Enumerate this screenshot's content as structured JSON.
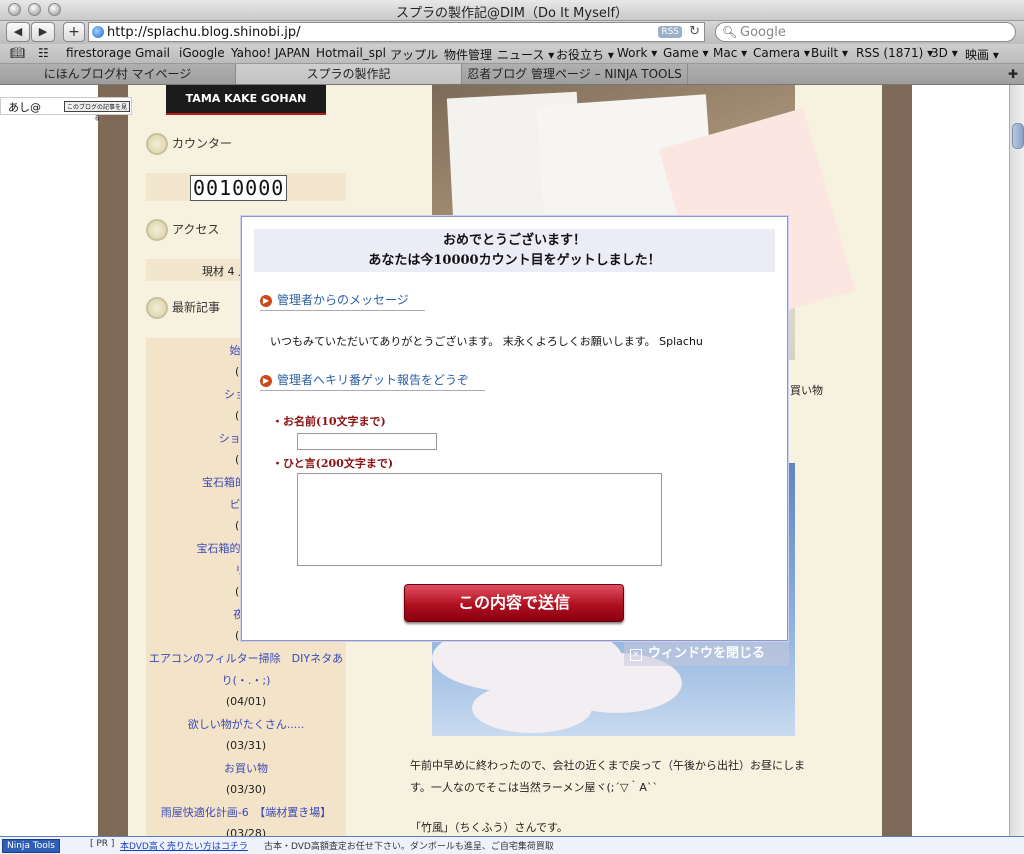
{
  "window": {
    "title": "スプラの製作記@DIM（Do It Myself）"
  },
  "toolbar": {
    "back": "◀",
    "forward": "▶",
    "add": "+",
    "url": "http://splachu.blog.shinobi.jp/",
    "rss": "RSS",
    "reload": "↻",
    "search_placeholder": "Google"
  },
  "bookmarks": [
    "firestorage",
    "Gmail",
    "iGoogle",
    "Yahoo! JAPAN",
    "Hotmail_spl",
    "アップル",
    "物件管理",
    "ニュース ▾",
    "お役立ち ▾",
    "Work ▾",
    "Game ▾",
    "Mac ▾",
    "Camera ▾",
    "Built ▾",
    "RSS (1871) ▾",
    "3D ▾",
    "映画 ▾"
  ],
  "tabs": [
    "にほんブログ村 マイページ",
    "スプラの製作記",
    "忍者ブログ 管理ページ – NINJA TOOLS"
  ],
  "ashi": {
    "label": "あし@",
    "button": "このブログの記事を見る"
  },
  "sidebar": {
    "logo": "TAMA KAKE GOHAN",
    "counter_title": "カウンター",
    "counter_value": "0010000",
    "access_title": "アクセス",
    "access_text": "現材 4 人",
    "recent_title": "最新記事",
    "recent": [
      {
        "title": "始業式",
        "date": "(04/"
      },
      {
        "title": "ショッキ",
        "date": "(04/"
      },
      {
        "title": "ショッキン",
        "date": "(04/"
      },
      {
        "title": "宝石箱的な物　そ",
        "date": ""
      },
      {
        "title": "ビュー",
        "date": "(04/"
      },
      {
        "title": "宝石箱的な物　その",
        "date": ""
      },
      {
        "title": "リー",
        "date": "(04/"
      },
      {
        "title": "夜桜.",
        "date": "(04/"
      },
      {
        "title": "エアコンのフィルター掃除　DIYネタあ",
        "date": ""
      },
      {
        "title": "り(・.・;)",
        "date": "(04/01)"
      },
      {
        "title": "欲しい物がたくさん.....",
        "date": "(03/31)"
      },
      {
        "title": "お買い物",
        "date": "(03/30)"
      },
      {
        "title": "雨屋快適化計画-6　【端材置き場】",
        "date": "(03/28)"
      }
    ]
  },
  "main": {
    "side_text": "買い物",
    "paragraph1": "午前中早めに終わったので、会社の近くまで戻って（午後から出社）お昼にします。一人なのでそこは当然ラーメン屋ヾ(;´▽｀A``",
    "paragraph2": "「竹風」（ちくふう）さんです。"
  },
  "modal": {
    "headline1": "おめでとうございます！",
    "headline2": "あなたは今10000カウント目をゲットしました！",
    "section1": "管理者からのメッセージ",
    "message": "いつもみていただいてありがとうございます。 末永くよろしくお願いします。 Splachu",
    "section2": "管理者へキリ番ゲット報告をどうぞ",
    "name_label": "・お名前(10文字まで)",
    "comment_label": "・ひと言(200文字まで)",
    "name_value": "",
    "comment_value": "",
    "submit": "この内容で送信",
    "close": "ウィンドウを閉じる"
  },
  "statusbar": {
    "ninja": "Ninja Tools",
    "pr": "[ PR ]",
    "link": "本DVD高く売りたい方はコチラ",
    "text": "古本・DVD高額査定お任せ下さい。ダンボールも進呈、ご自宅集荷買取"
  }
}
